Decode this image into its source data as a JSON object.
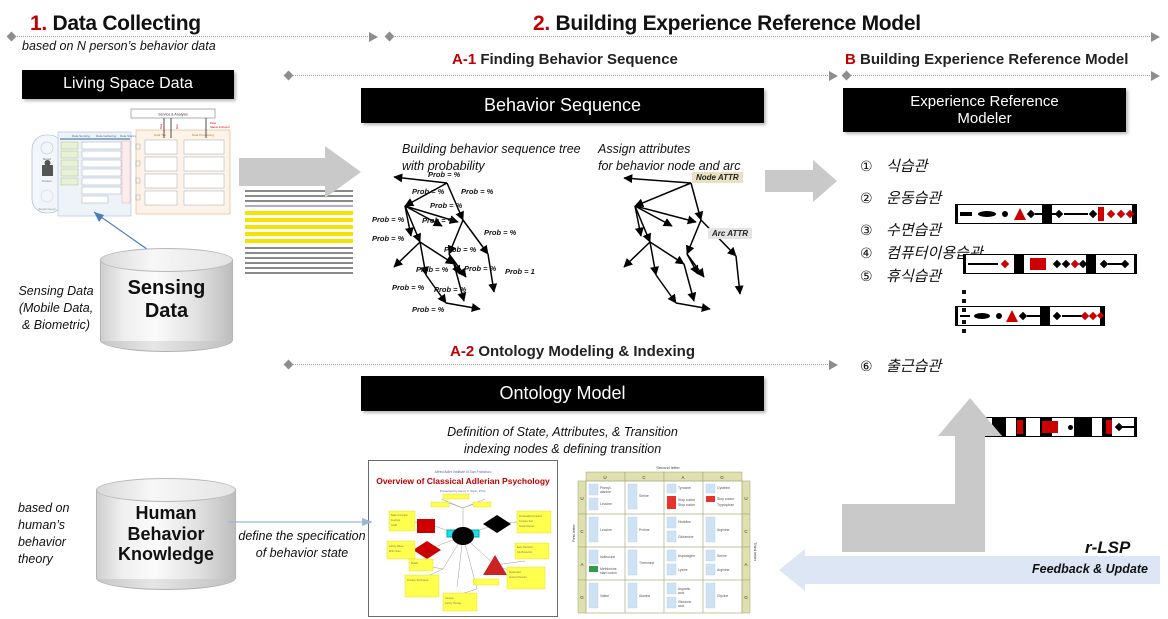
{
  "phases": {
    "one": {
      "num": "1.",
      "title": "Data Collecting"
    },
    "two": {
      "num": "2.",
      "title": "Building Experience Reference Model"
    }
  },
  "subphases": {
    "a1": {
      "num": "A-1",
      "title": "Finding Behavior Sequence"
    },
    "b": {
      "num": "B",
      "title": "Building Experience Reference Model"
    },
    "a2": {
      "num": "A-2",
      "title": "Ontology Modeling & Indexing"
    }
  },
  "boxes": {
    "living_space_data": "Living Space Data",
    "behavior_sequence": "Behavior Sequence",
    "experience_reference_modeler": "Experience  Reference\nModeler",
    "ontology_model": "Ontology Model"
  },
  "captions": {
    "based_on_n_person": "based on N person’s behavior data",
    "sensing_data_note": "Sensing Data\n(Mobile Data,\n& Biometric)",
    "human_theory_note": "based on\nhuman’s\nbehavior\ntheory",
    "define_spec": "define the specification\nof behavior state",
    "tree_left": "Building behavior sequence tree\nwith probability",
    "tree_right": "Assign attributes\nfor behavior node and arc",
    "ontology_note": "Definition of State, Attributes, & Transition\nindexing nodes & defining transition"
  },
  "cylinders": {
    "sensing": "Sensing\nData",
    "knowledge": "Human\nBehavior\nKnowledge"
  },
  "tree_labels": {
    "node_attr": "Node ATTR",
    "arc_attr": "Arc ATTR",
    "prob_generic": "Prob = %",
    "prob_one": "Prob = 1",
    "probs": [
      "Prob = %",
      "Prob = %",
      "Prob = %",
      "Prob = %",
      "Prob = %",
      "Prob = %",
      "Prob = %",
      "Prob = %",
      "Prob = %",
      "Prob = %",
      "Prob = %",
      "Prob = %",
      "Prob = %",
      "Prob = %",
      "Prob = 1"
    ]
  },
  "habits": {
    "items": [
      {
        "num": "①",
        "label": "식습관",
        "has_bar": false
      },
      {
        "num": "②",
        "label": "운동습관",
        "has_bar": true
      },
      {
        "num": "③",
        "label": "수면습관",
        "has_bar": true
      },
      {
        "num": "④",
        "label": "컴퓨터이용습관",
        "has_bar": false
      },
      {
        "num": "⑤",
        "label": "휴식습관",
        "has_bar": true
      },
      {
        "num": "⑥",
        "label": "출근습관",
        "has_bar": true
      }
    ]
  },
  "feedback": {
    "title": "r-LSP",
    "text": "Feedback & Update"
  },
  "mindmap": {
    "supertitle": "Alfred Adler Institute of San Francisco",
    "title": "Overview of Classical Adlerian Psychology",
    "subtitle": "Presented by Henry T. Stein, Ph.D."
  },
  "codon": {
    "top_header": "Second letter",
    "left_header": "First letter",
    "right_header": "Third letter",
    "columns": [
      "U",
      "C",
      "A",
      "G"
    ],
    "rows": [
      "U",
      "C",
      "A",
      "G"
    ],
    "amino_acids": [
      "Phenyl-\nalanine",
      "Serine",
      "Tyrosine",
      "Cysteine",
      "Leucine",
      "Stop codon",
      "Stop codon",
      "Tryptophan",
      "Leucine",
      "Proline",
      "Histidine",
      "Arginine",
      "Glutamine",
      "Isoleucine",
      "Threonine",
      "Asparagine",
      "Serine",
      "Lysine",
      "Arginine",
      "Methionine\nstart codon",
      "Valine",
      "Alanine",
      "Aspartic\nacid",
      "Glutamic\nacid",
      "Glycine"
    ]
  },
  "colors": {
    "accent_red": "#c00000",
    "gray_arrow": "#c9c9c9",
    "feedback_blue": "#dce6f4",
    "highlight_yellow": "#f2e400"
  }
}
